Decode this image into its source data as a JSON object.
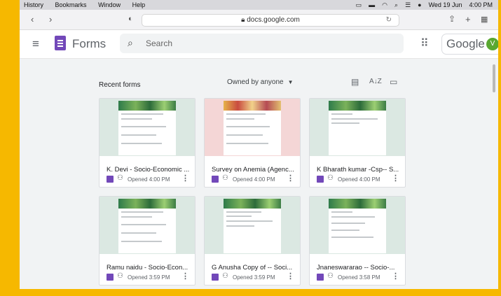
{
  "menubar": {
    "items": [
      "History",
      "Bookmarks",
      "Window",
      "Help"
    ],
    "date": "Wed 19 Jun",
    "time": "4:00 PM"
  },
  "browser": {
    "address": "docs.google.com"
  },
  "header": {
    "app_name": "Forms",
    "search_placeholder": "Search",
    "account_text": "Google",
    "avatar_initial": "V"
  },
  "main": {
    "section_title": "Recent forms",
    "owner_filter": "Owned by anyone",
    "cards": [
      {
        "title": "K. Devi - Socio-Economic ...",
        "opened": "Opened 4:00 PM",
        "thumb": "green"
      },
      {
        "title": "Survey on Anemia (Agenc...",
        "opened": "Opened 4:00 PM",
        "thumb": "pink"
      },
      {
        "title": "K Bharath kumar -Csp-- S...",
        "opened": "Opened 4:00 PM",
        "thumb": "green"
      },
      {
        "title": "Ramu naidu - Socio-Econ...",
        "opened": "Opened 3:59 PM",
        "thumb": "green"
      },
      {
        "title": "G Anusha Copy of -- Soci...",
        "opened": "Opened 3:59 PM",
        "thumb": "green"
      },
      {
        "title": "Jnaneswararao -- Socio-...",
        "opened": "Opened 3:58 PM",
        "thumb": "green"
      }
    ]
  },
  "colors": {
    "frame_border": "#f6b800",
    "forms_purple": "#7248b9",
    "avatar_green": "#5aa832"
  }
}
